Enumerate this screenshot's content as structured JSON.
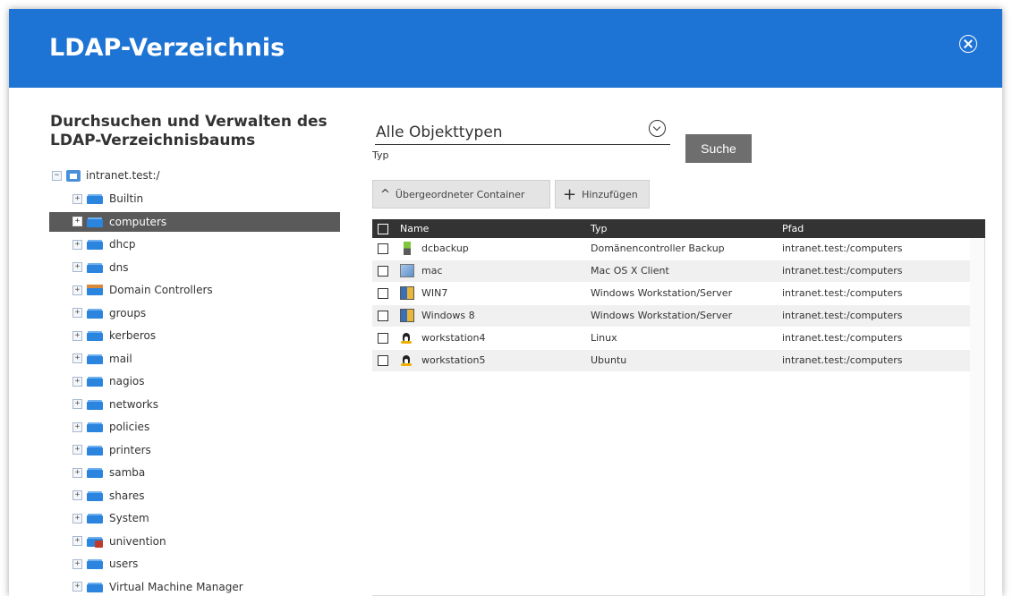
{
  "dialog": {
    "title": "LDAP-Verzeichnis"
  },
  "left": {
    "title_line1": "Durchsuchen und Verwalten des",
    "title_line2": "LDAP-Verzeichnisbaums",
    "root": "intranet.test:/",
    "items": [
      {
        "label": "Builtin",
        "icon": "folder-icon"
      },
      {
        "label": "computers",
        "icon": "folder-icon",
        "selected": true
      },
      {
        "label": "dhcp",
        "icon": "folder-icon"
      },
      {
        "label": "dns",
        "icon": "folder-icon"
      },
      {
        "label": "Domain Controllers",
        "icon": "dc-folder-icon"
      },
      {
        "label": "groups",
        "icon": "folder-icon"
      },
      {
        "label": "kerberos",
        "icon": "folder-icon"
      },
      {
        "label": "mail",
        "icon": "folder-icon"
      },
      {
        "label": "nagios",
        "icon": "folder-icon"
      },
      {
        "label": "networks",
        "icon": "folder-icon"
      },
      {
        "label": "policies",
        "icon": "folder-icon"
      },
      {
        "label": "printers",
        "icon": "folder-icon"
      },
      {
        "label": "samba",
        "icon": "folder-icon"
      },
      {
        "label": "shares",
        "icon": "folder-icon"
      },
      {
        "label": "System",
        "icon": "folder-icon"
      },
      {
        "label": "univention",
        "icon": "univention-folder-icon"
      },
      {
        "label": "users",
        "icon": "folder-icon"
      },
      {
        "label": "Virtual Machine Manager",
        "icon": "folder-icon"
      }
    ]
  },
  "search": {
    "type_value": "Alle Objekttypen",
    "type_label": "Typ",
    "search_label": "Suche"
  },
  "toolbar": {
    "parent_label": "Übergeordneter Container",
    "add_label": "Hinzufügen"
  },
  "grid": {
    "columns": [
      "Name",
      "Typ",
      "Pfad"
    ],
    "rows": [
      {
        "name": "dcbackup",
        "type": "Domänencontroller Backup",
        "path": "intranet.test:/computers",
        "icon": "dc-backup-icon"
      },
      {
        "name": "mac",
        "type": "Mac OS X Client",
        "path": "intranet.test:/computers",
        "icon": "mac-icon"
      },
      {
        "name": "WIN7",
        "type": "Windows Workstation/Server",
        "path": "intranet.test:/computers",
        "icon": "windows-icon"
      },
      {
        "name": "Windows 8",
        "type": "Windows Workstation/Server",
        "path": "intranet.test:/computers",
        "icon": "windows-icon"
      },
      {
        "name": "workstation4",
        "type": "Linux",
        "path": "intranet.test:/computers",
        "icon": "linux-icon"
      },
      {
        "name": "workstation5",
        "type": "Ubuntu",
        "path": "intranet.test:/computers",
        "icon": "linux-icon"
      }
    ]
  }
}
